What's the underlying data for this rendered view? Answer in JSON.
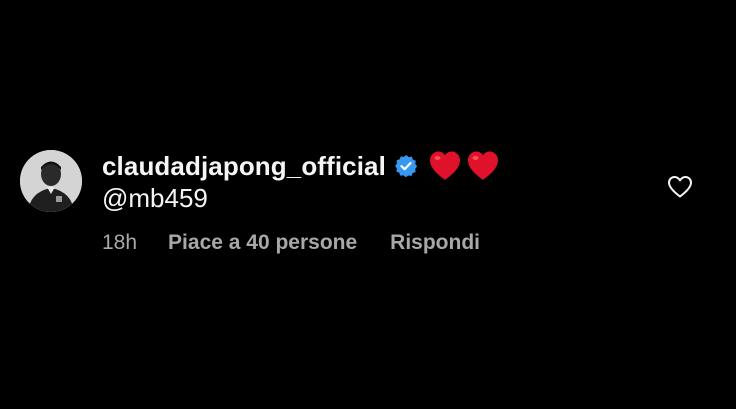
{
  "comment": {
    "username": "claudadjapong_official",
    "verified_icon": "verified-badge-icon",
    "verified_color": "#3897f0",
    "emoji": [
      "❤️",
      "❤️"
    ],
    "text": "@mb459",
    "time": "18h",
    "likes": "Piace a 40 persone",
    "reply": "Rispondi",
    "like_icon": "heart-outline-icon"
  },
  "colors": {
    "background": "#000000",
    "text": "#f5f5f5",
    "secondary": "#a8a8a8",
    "heart_emoji": "#e0112b"
  }
}
